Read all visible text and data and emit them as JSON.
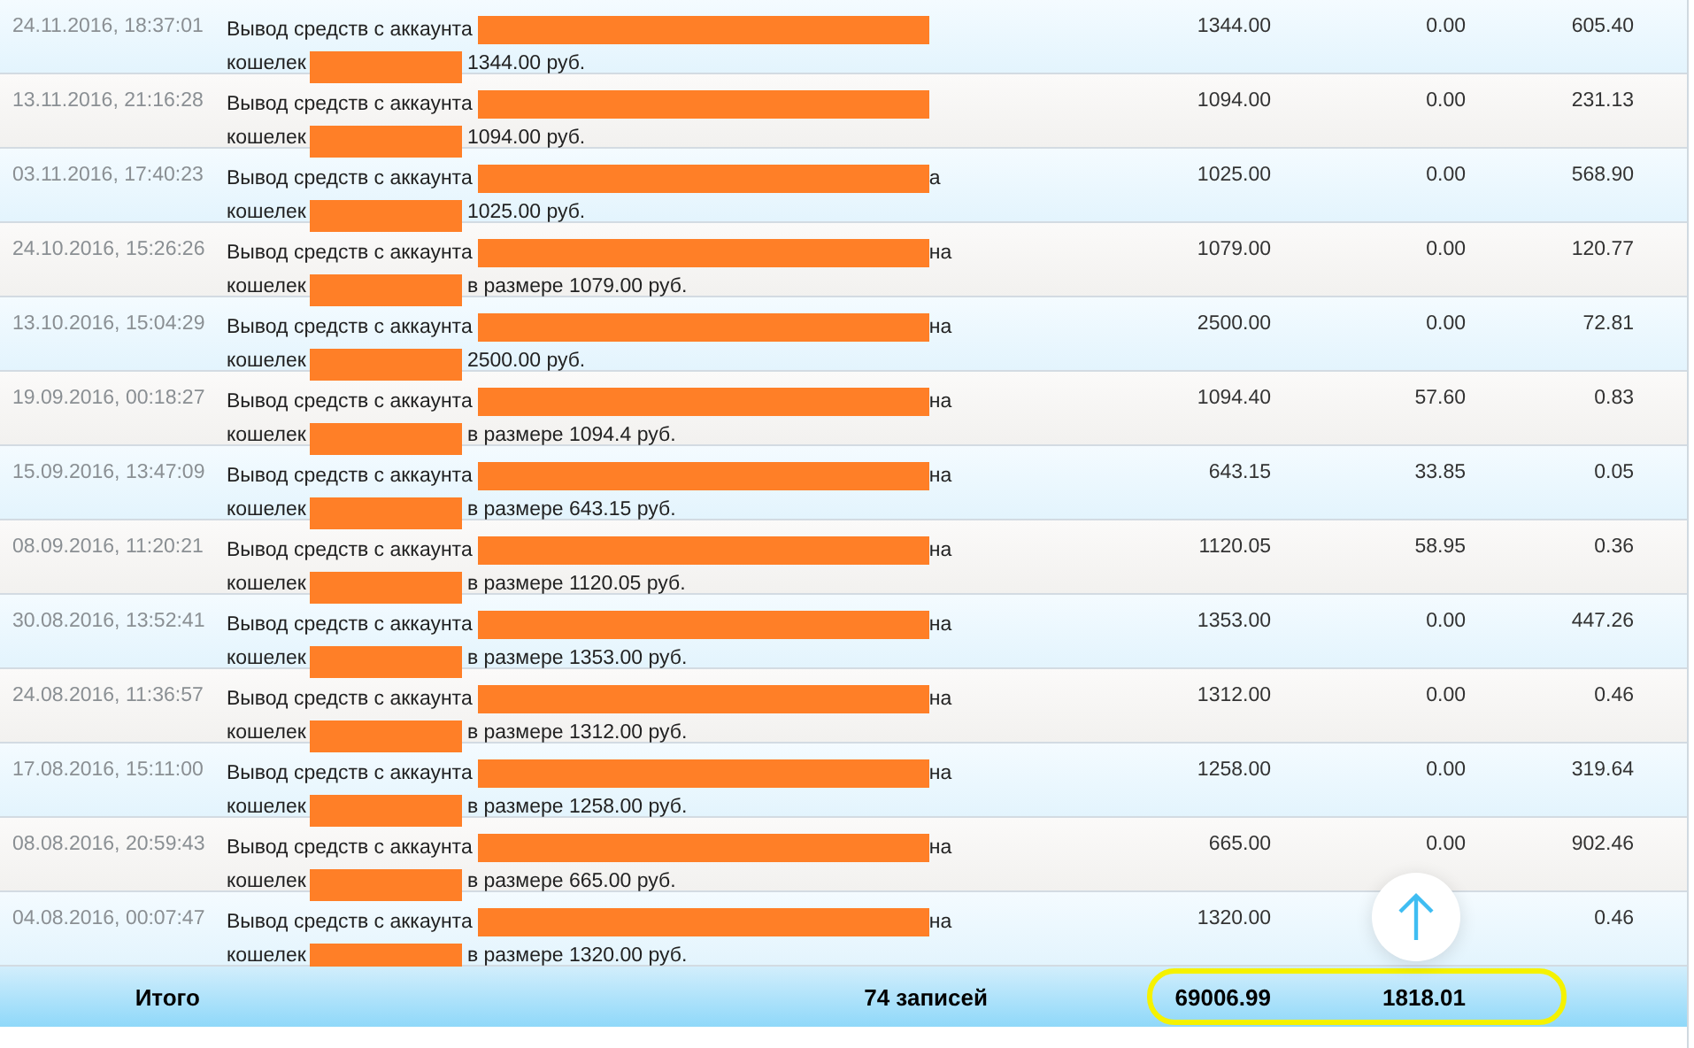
{
  "rows": [
    {
      "date": "24.11.2016, 18:37:01",
      "description": {
        "line1": "Вывод средств с аккаунта",
        "line2": "кошелек",
        "line2_tail": "1344.00 руб."
      },
      "column_3": "1344.00",
      "column_4": "0.00",
      "column_5": "605.40"
    },
    {
      "date": "13.11.2016, 21:16:28",
      "description": {
        "line1": "Вывод средств с аккаунта",
        "line2": "кошелек",
        "line2_tail": "1094.00 руб."
      },
      "column_3": "1094.00",
      "column_4": "0.00",
      "column_5": "231.13"
    },
    {
      "date": "03.11.2016, 17:40:23",
      "description": {
        "line1": "Вывод средств с аккаунта",
        "line1_tail": "а",
        "line2": "кошелек",
        "line2_tail": "1025.00 руб."
      },
      "column_3": "1025.00",
      "column_4": "0.00",
      "column_5": "568.90"
    },
    {
      "date": "24.10.2016, 15:26:26",
      "description": {
        "line1": "Вывод средств с аккаунта",
        "line1_tail": "на",
        "line2": "кошелек",
        "line2_tail": "в размере 1079.00 руб."
      },
      "column_3": "1079.00",
      "column_4": "0.00",
      "column_5": "120.77"
    },
    {
      "date": "13.10.2016, 15:04:29",
      "description": {
        "line1": "Вывод средств с аккаунта",
        "line1_tail": "на",
        "line2": "кошелек",
        "line2_tail": "2500.00 руб."
      },
      "column_3": "2500.00",
      "column_4": "0.00",
      "column_5": "72.81"
    },
    {
      "date": "19.09.2016, 00:18:27",
      "description": {
        "line1": "Вывод средств с аккаунта",
        "line1_tail": "на",
        "line2": "кошелек",
        "line2_tail": "в размере 1094.4 руб."
      },
      "column_3": "1094.40",
      "column_4": "57.60",
      "column_5": "0.83"
    },
    {
      "date": "15.09.2016, 13:47:09",
      "description": {
        "line1": "Вывод средств с аккаунта",
        "line1_tail": "на",
        "line2": "кошелек",
        "line2_tail": "в размере 643.15 руб."
      },
      "column_3": "643.15",
      "column_4": "33.85",
      "column_5": "0.05"
    },
    {
      "date": "08.09.2016, 11:20:21",
      "description": {
        "line1": "Вывод средств с аккаунта",
        "line1_tail": "на",
        "line2": "кошелек",
        "line2_tail": "в размере 1120.05 руб."
      },
      "column_3": "1120.05",
      "column_4": "58.95",
      "column_5": "0.36"
    },
    {
      "date": "30.08.2016, 13:52:41",
      "description": {
        "line1": "Вывод средств с аккаунта",
        "line1_tail": "на",
        "line2": "кошелек",
        "line2_tail": "в размере 1353.00 руб."
      },
      "column_3": "1353.00",
      "column_4": "0.00",
      "column_5": "447.26"
    },
    {
      "date": "24.08.2016, 11:36:57",
      "description": {
        "line1": "Вывод средств с аккаунта",
        "line1_tail": "на",
        "line2": "кошелек",
        "line2_tail": "в размере 1312.00 руб."
      },
      "column_3": "1312.00",
      "column_4": "0.00",
      "column_5": "0.46"
    },
    {
      "date": "17.08.2016, 15:11:00",
      "description": {
        "line1": "Вывод средств с аккаунта",
        "line1_tail": "на",
        "line2": "кошелек",
        "line2_tail": "в размере 1258.00 руб."
      },
      "column_3": "1258.00",
      "column_4": "0.00",
      "column_5": "319.64"
    },
    {
      "date": "08.08.2016, 20:59:43",
      "description": {
        "line1": "Вывод средств с аккаунта",
        "line1_tail": "на",
        "line2": "кошелек",
        "line2_tail": "в размере 665.00 руб."
      },
      "column_3": "665.00",
      "column_4": "0.00",
      "column_5": "902.46"
    },
    {
      "date": "04.08.2016, 00:07:47",
      "description": {
        "line1": "Вывод средств с аккаунта",
        "line1_tail": "на",
        "line2": "кошелек",
        "line2_tail": "в размере 1320.00 руб."
      },
      "column_3": "1320.00",
      "column_5": "0.46"
    }
  ],
  "footer": {
    "label": "Итого",
    "count": "74 записей",
    "total_3": "69006.99",
    "total_4": "1818.01"
  }
}
